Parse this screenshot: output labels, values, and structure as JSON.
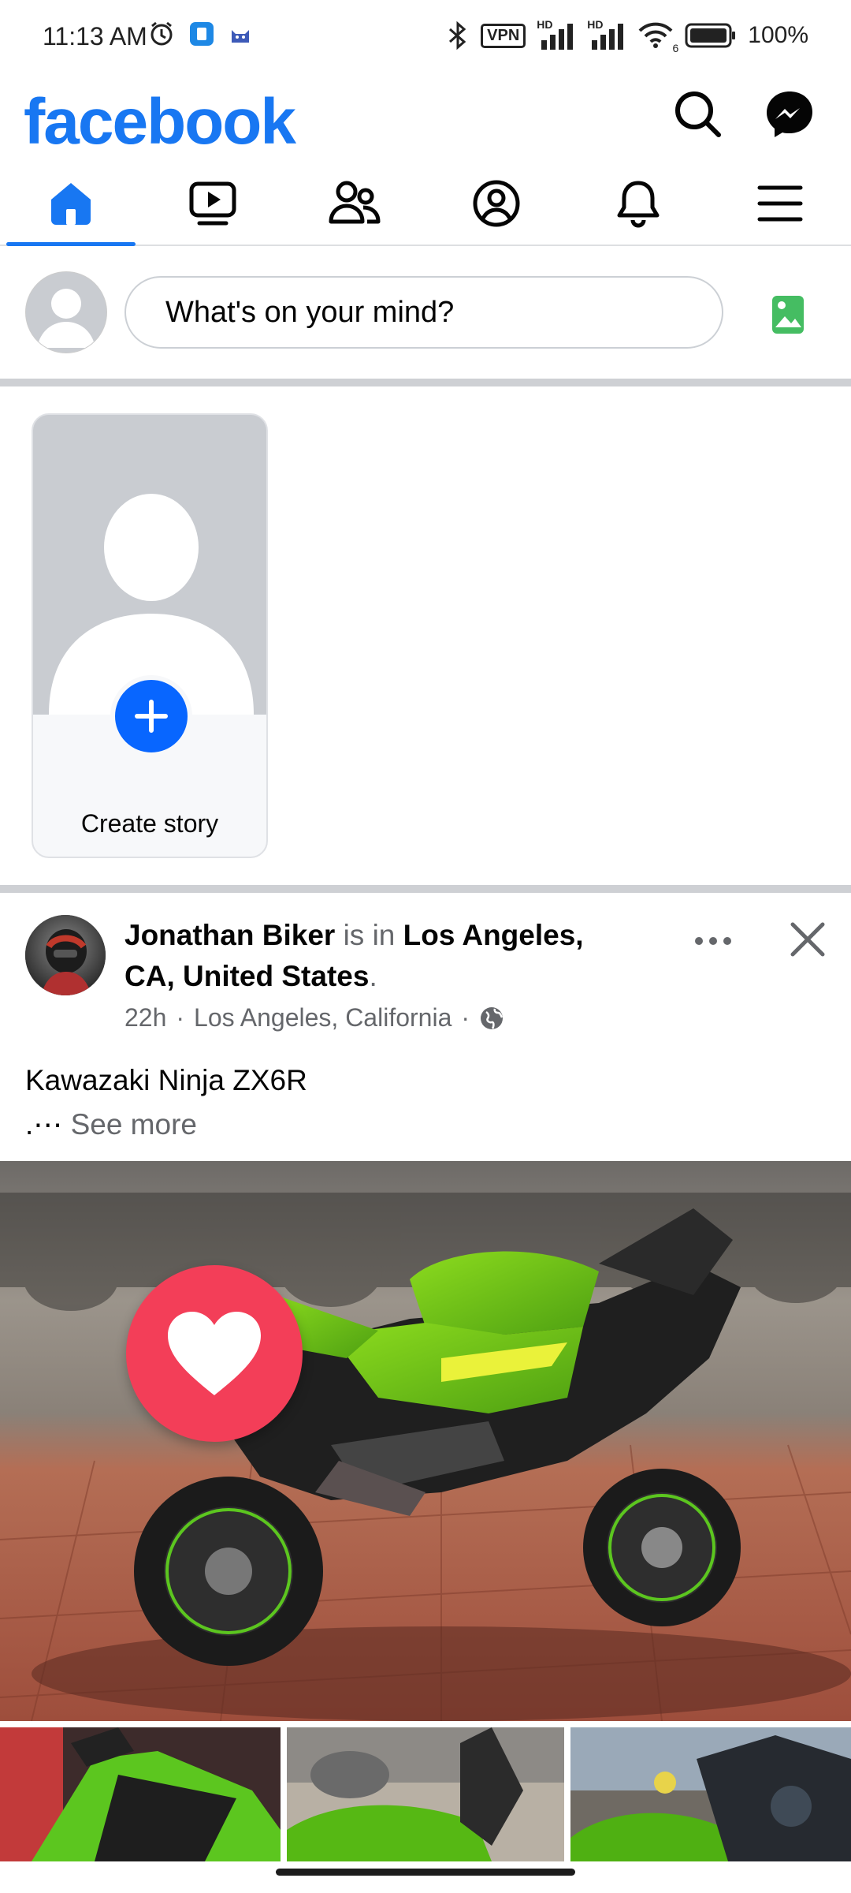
{
  "status_bar": {
    "time": "11:13 AM",
    "battery": "100%",
    "vpn": "VPN",
    "hd1": "HD",
    "hd2": "HD",
    "wifi_sub": "6"
  },
  "header": {
    "logo": "facebook"
  },
  "composer": {
    "placeholder": "What's on your mind?"
  },
  "stories": {
    "create_label": "Create story"
  },
  "post": {
    "author": "Jonathan Biker",
    "is_in": " is in ",
    "location": "Los Angeles, CA, United States",
    "period": ".",
    "time": "22h",
    "sep1": "·",
    "place": "Los Angeles, California",
    "sep2": "·",
    "text": "Kawazaki Ninja ZX6R",
    "ellipsis": ".⋯",
    "see_more": "See more"
  },
  "colors": {
    "brand": "#1877f2",
    "story_plus": "#0866ff",
    "photo_icon": "#45bd62",
    "love": "#f33e58"
  },
  "icons": [
    "search-icon",
    "messenger-icon",
    "home-icon",
    "video-icon",
    "friends-icon",
    "profile-icon",
    "bell-icon",
    "menu-icon",
    "photo-icon",
    "plus-icon",
    "more-icon",
    "close-icon",
    "globe-icon",
    "love-reaction-icon"
  ]
}
